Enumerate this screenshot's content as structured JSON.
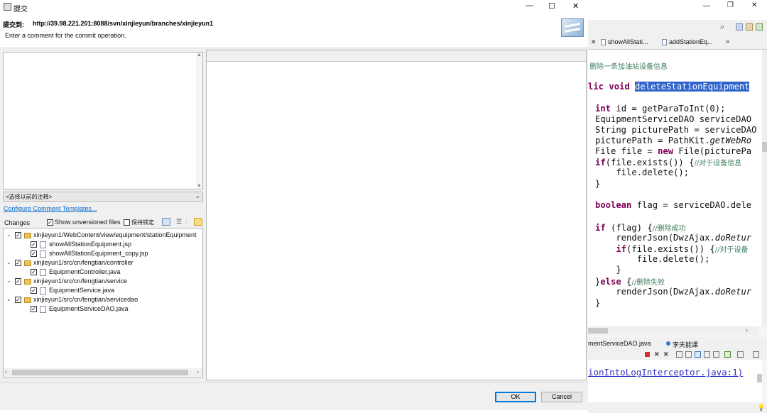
{
  "ide": {
    "tabs": [
      "showAllStati...",
      "addStationEq...",
      "»"
    ],
    "code": [
      {
        "segments": [
          {
            "t": "删除一条加油站设备信息",
            "c": "cm"
          }
        ]
      },
      {
        "segments": [
          {
            "t": "lic ",
            "c": "kw"
          },
          {
            "t": "void ",
            "c": "kw"
          },
          {
            "t": "deleteStationEquipment",
            "c": "sel"
          }
        ]
      },
      {
        "segments": [
          {
            "t": "int ",
            "c": "kw"
          },
          {
            "t": "id = getParaToInt(0);"
          }
        ]
      },
      {
        "segments": [
          {
            "t": "EquipmentServiceDAO serviceDAO"
          }
        ]
      },
      {
        "segments": [
          {
            "t": "String picturePath = serviceDAO"
          }
        ]
      },
      {
        "segments": [
          {
            "t": "picturePath = PathKit."
          },
          {
            "t": "getWebRo",
            "c": "it"
          }
        ]
      },
      {
        "segments": [
          {
            "t": "File file = "
          },
          {
            "t": "new ",
            "c": "kw"
          },
          {
            "t": "File(picturePa"
          }
        ]
      },
      {
        "segments": [
          {
            "t": "if",
            "c": "kw"
          },
          {
            "t": "(file.exists()) {"
          },
          {
            "t": "//对于设备信息",
            "c": "cm"
          }
        ]
      },
      {
        "segments": [
          {
            "t": "    file.delete();"
          }
        ]
      },
      {
        "segments": [
          {
            "t": "}"
          }
        ]
      },
      {
        "segments": [
          {
            "t": "boolean ",
            "c": "kw"
          },
          {
            "t": "flag = serviceDAO.dele"
          }
        ]
      },
      {
        "segments": [
          {
            "t": "if ",
            "c": "kw"
          },
          {
            "t": "(flag) {"
          },
          {
            "t": "//删除成功",
            "c": "cm"
          }
        ]
      },
      {
        "segments": [
          {
            "t": "    renderJson(DwzAjax."
          },
          {
            "t": "doRetur",
            "c": "it"
          }
        ]
      },
      {
        "segments": [
          {
            "t": "    "
          },
          {
            "t": "if",
            "c": "kw"
          },
          {
            "t": "(file.exists()) {"
          },
          {
            "t": "//对于设备",
            "c": "cm"
          }
        ]
      },
      {
        "segments": [
          {
            "t": "        file.delete();"
          }
        ]
      },
      {
        "segments": [
          {
            "t": "    }"
          }
        ]
      },
      {
        "segments": [
          {
            "t": "}"
          },
          {
            "t": "else ",
            "c": "kw"
          },
          {
            "t": "{"
          },
          {
            "t": "//删除失败",
            "c": "cm"
          }
        ]
      },
      {
        "segments": [
          {
            "t": "    renderJson(DwzAjax."
          },
          {
            "t": "doRetur",
            "c": "it"
          }
        ]
      },
      {
        "segments": [
          {
            "t": "}"
          }
        ]
      }
    ],
    "console_tabs": [
      "mentServiceDAO.java",
      "李天能课"
    ],
    "console_line": "ionIntoLogInterceptor.java:1)"
  },
  "dialog": {
    "title": "提交",
    "commit_to_label": "提交到:",
    "commit_url": "http://39.98.221.201:8088/svn/xinjieyun/branches/xinjieyun1",
    "instruction": "Enter a comment for the commit operation.",
    "comment_value": "",
    "previous_comments": "<选择以前的注释>",
    "configure_templates_link": "Configure Comment Templates...",
    "changes_label": "Changes",
    "show_unversioned": "Show unversioned files",
    "keep_locks": "保持锁定",
    "tree": [
      {
        "type": "folder",
        "label": "xinjieyun1/WebContent/view/equipment/stationEquipment",
        "checked": true
      },
      {
        "type": "file",
        "label": "showAllStationEquipment.jsp",
        "checked": true
      },
      {
        "type": "file",
        "label": "showAllStationEquipment_copy.jsp",
        "checked": true
      },
      {
        "type": "folder",
        "label": "xinjieyun1/src/cn/fengtian/controller",
        "checked": true
      },
      {
        "type": "file",
        "label": "EquipmentController.java",
        "checked": true
      },
      {
        "type": "folder",
        "label": "xinjieyun1/src/cn/fengtian/service",
        "checked": true
      },
      {
        "type": "file",
        "label": "EquipmentService.java",
        "checked": true
      },
      {
        "type": "folder",
        "label": "xinjieyun1/src/cn/fengtian/servicedao",
        "checked": true
      },
      {
        "type": "file",
        "label": "EquipmentServiceDAO.java",
        "checked": true
      }
    ],
    "ok_label": "OK",
    "cancel_label": "Cancel",
    "minimize_glyph": "—",
    "maximize_glyph": "☐",
    "close_glyph": "✕"
  },
  "colors": {
    "selection": "#2f65ca",
    "keyword": "#7f0055",
    "comment": "#3f7f5f",
    "link": "#0066cc"
  }
}
